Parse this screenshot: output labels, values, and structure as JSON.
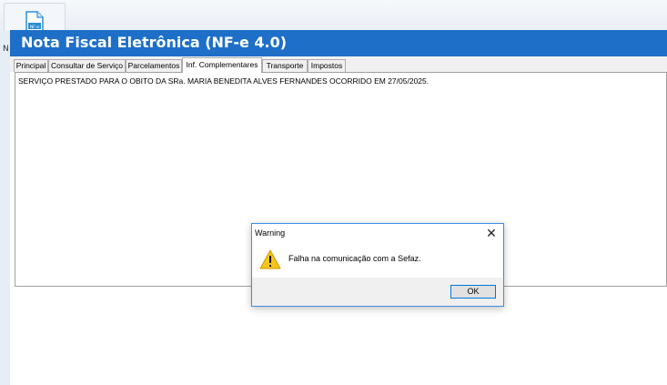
{
  "parent_app": {
    "icon": "nfe-document-icon",
    "icon_caption": "NF-e",
    "left_letter": "N"
  },
  "window": {
    "title": "Nota Fiscal Eletrônica (NF-e 4.0)",
    "title_bar_color": "#1e6fc8"
  },
  "tabs": [
    {
      "label": "Principal",
      "active": false
    },
    {
      "label": "Consultar de Serviço",
      "active": false
    },
    {
      "label": "Parcelamentos",
      "active": false
    },
    {
      "label": "Inf. Complementares",
      "active": true
    },
    {
      "label": "Transporte",
      "active": false
    },
    {
      "label": "Impostos",
      "active": false
    }
  ],
  "content": {
    "memo_text": "SERVIÇO PRESTADO PARA O OBITO DA SRa. MARIA BENEDITA ALVES FERNANDES OCORRIDO EM 27/05/2025."
  },
  "dialog": {
    "title": "Warning",
    "close_icon": "close-icon",
    "icon": "warning-icon",
    "message": "Falha na comunicação com a Sefaz.",
    "ok_label": "OK",
    "border_color": "#3c8ee0"
  }
}
